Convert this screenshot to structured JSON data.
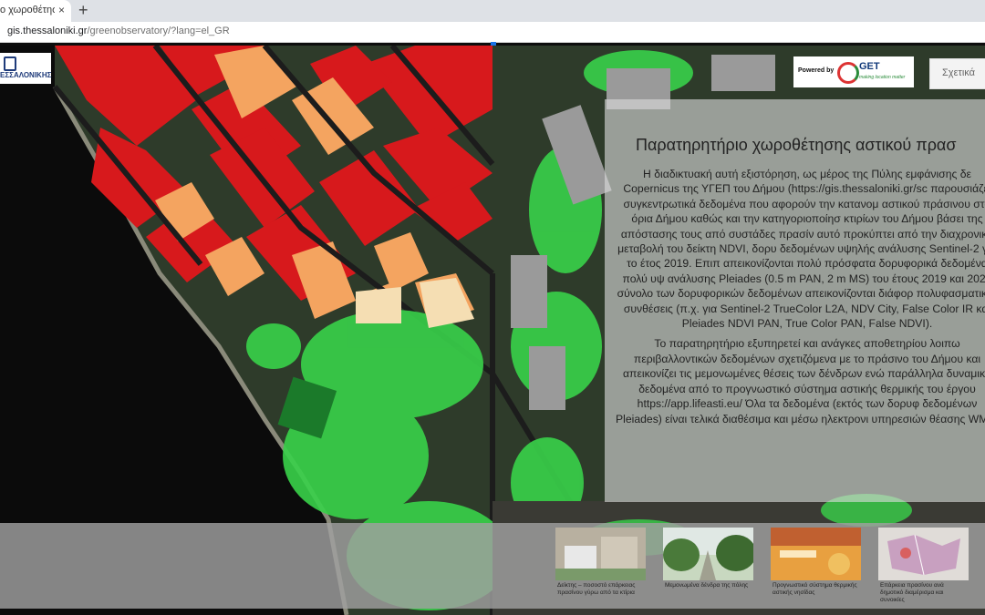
{
  "browser": {
    "tab_title": "ο χωροθέτησης α",
    "tab_close": "×",
    "new_tab": "+",
    "url_host": "gis.thessaloniki.gr",
    "url_path": "/greenobservatory/?lang=el_GR"
  },
  "logo": {
    "text": "ΕΣΣΑΛΟΝΙΚΗΣ"
  },
  "powered_by": {
    "label": "Powered by",
    "brand": "GET",
    "tagline": "making location matter"
  },
  "about_button": {
    "label": "Σχετικά"
  },
  "info_panel": {
    "title": "Παρατηρητήριο χωροθέτησης αστικού πρασ",
    "paragraph_1": "Η διαδικτυακή αυτή εξιστόρηση, ως μέρος της Πύλης εμφάνισης δε Copernicus της ΥΓΕΠ του Δήμου (https://gis.thessaloniki.gr/sc παρουσιάζει συγκεντρωτικά δεδομένα που αφορούν την κατανομ αστικού πράσινου στα όρια Δήμου καθώς και την κατηγοριοποίησ κτιρίων του Δήμου βάσει της απόστασης τους από συστάδες πρασίν αυτό προκύπτει από την διαχρονική μεταβολή του δείκτη NDVI, δορυ δεδομένων υψηλής ανάλυσης Sentinel-2 για το έτος 2019. Επιπ απεικονίζονται πολύ πρόσφατα δορυφορικά δεδομένα πολύ υψ ανάλυσης Pleiades (0.5 m PAN, 2 m MS) του έτους 2019 και 2020 σύνολο των δορυφορικών δεδομένων απεικονίζονται διάφορ πολυφασματικές συνθέσεις (π.χ. για Sentinel-2 TrueColor L2A, NDV City, False Color IR και Pleiades NDVI PAN, True Color PAN, False NDVI).",
    "paragraph_2": "Το παρατηρητήριο εξυπηρετεί και ανάγκες αποθετηρίου λοιπω περιβαλλοντικών δεδομένων σχετιζόμενα με το πράσινο του Δήμου και απεικονίζει τις μεμονωμένες θέσεις των δένδρων ενώ παράλληλα δυναμικά δεδομένα από το προγνωστικό σύστημα αστικής θερμικής του έργου https://app.lifeasti.eu/ Όλα τα δεδομένα (εκτός των δορυφ δεδομένων Pleiades) είναι τελικά διαθέσιμα και μέσω ηλεκτρονι υπηρεσιών θέασης WMS."
  },
  "thumbnails": [
    {
      "caption": "Δείκτης – ποσοστό επάρκειας πρασίνου γύρω από τα κτίρια"
    },
    {
      "caption": "Μεμονωμένα δένδρα της πόλης"
    },
    {
      "caption": "Προγνωστικό σύστημα θερμικής αστικής νησίδας"
    },
    {
      "caption": "Επάρκεια πρασίνου ανά δημοτικό διαμέρισμα και συνοικίες"
    }
  ],
  "colors": {
    "building_red": "#d7191c",
    "building_orange": "#f4a460",
    "vegetation": "#39d24a",
    "sea": "#0b0b0b",
    "loading_bar": "#1a73e8"
  }
}
